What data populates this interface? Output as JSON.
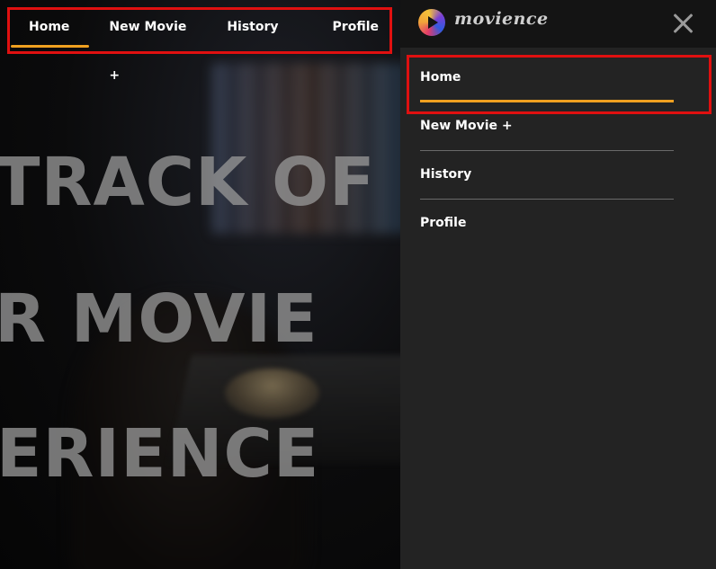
{
  "hero": {
    "line1": "TRACK OF",
    "line2": "R MOVIE",
    "line3": "ERIENCE"
  },
  "topnav": {
    "items": [
      {
        "label": "Home",
        "active": true
      },
      {
        "label": "New Movie +",
        "active": false
      },
      {
        "label": "History",
        "active": false
      },
      {
        "label": "Profile",
        "active": false
      }
    ]
  },
  "drawer": {
    "logo_text": "movience",
    "close_icon": "close-icon",
    "items": [
      {
        "label": "Home",
        "active": true
      },
      {
        "label": "New Movie +",
        "active": false
      },
      {
        "label": "History",
        "active": false
      },
      {
        "label": "Profile",
        "active": false
      }
    ]
  },
  "colors": {
    "accent": "#f0a020",
    "highlight_box": "#e01010",
    "drawer_bg": "#232323",
    "header_bg": "#141414"
  }
}
